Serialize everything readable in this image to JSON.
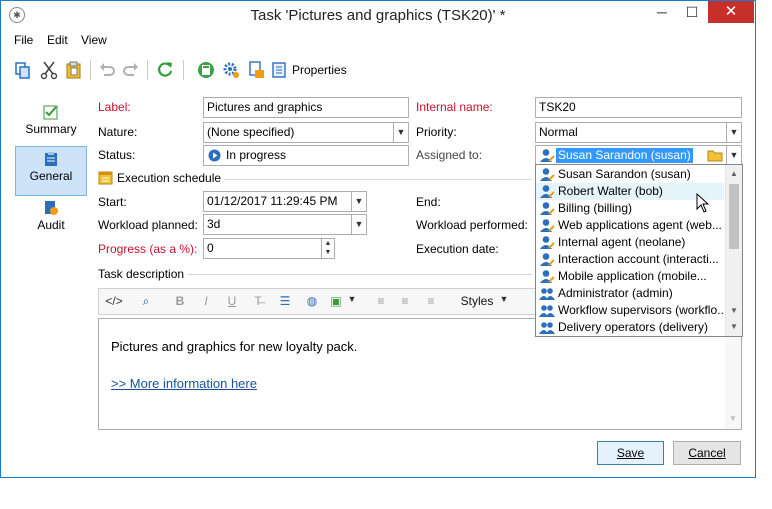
{
  "window": {
    "title": "Task 'Pictures and graphics (TSK20)' *",
    "minimize": "─",
    "maximize": "☐",
    "close": "✕"
  },
  "menu": [
    "File",
    "Edit",
    "View"
  ],
  "toolbar": {
    "properties_label": "Properties"
  },
  "sidebar": {
    "items": [
      {
        "label": "Summary"
      },
      {
        "label": "General"
      },
      {
        "label": "Audit"
      }
    ]
  },
  "form": {
    "label_label": "Label:",
    "label_value": "Pictures and graphics",
    "internal_name_label": "Internal name:",
    "internal_name_value": "TSK20",
    "nature_label": "Nature:",
    "nature_value": "(None specified)",
    "priority_label": "Priority:",
    "priority_value": "Normal",
    "status_label": "Status:",
    "status_value": "In progress",
    "assigned_label": "Assigned to:",
    "assigned_value": "Susan Sarandon (susan)",
    "execution_schedule_label": "Execution schedule",
    "start_label": "Start:",
    "start_value": "01/12/2017 11:29:45 PM",
    "end_label": "End:",
    "workload_planned_label": "Workload planned:",
    "workload_planned_value": "3d",
    "workload_performed_label": "Workload performed:",
    "progress_label": "Progress (as a %):",
    "progress_value": "0",
    "execution_date_label": "Execution date:",
    "task_description_label": "Task description"
  },
  "editor": {
    "styles_label": "Styles",
    "text": "Pictures and graphics for new loyalty pack.",
    "link": ">> More information here"
  },
  "dropdown": {
    "items": [
      {
        "label": "Susan Sarandon (susan)",
        "kind": "user"
      },
      {
        "label": "Robert Walter (bob)",
        "kind": "user"
      },
      {
        "label": "Billing (billing)",
        "kind": "user"
      },
      {
        "label": "Web applications agent (web...",
        "kind": "user"
      },
      {
        "label": "Internal agent (neolane)",
        "kind": "user"
      },
      {
        "label": "Interaction account (interacti...",
        "kind": "user"
      },
      {
        "label": "Mobile application (mobile...",
        "kind": "user"
      },
      {
        "label": "Administrator (admin)",
        "kind": "group"
      },
      {
        "label": "Workflow supervisors (workflo...",
        "kind": "group"
      },
      {
        "label": "Delivery operators (delivery)",
        "kind": "group"
      }
    ]
  },
  "buttons": {
    "save": "Save",
    "cancel": "Cancel"
  },
  "colors": {
    "accent": "#1979ca",
    "required": "#c8102e",
    "selection": "#3399ff",
    "link": "#1a0dab"
  }
}
